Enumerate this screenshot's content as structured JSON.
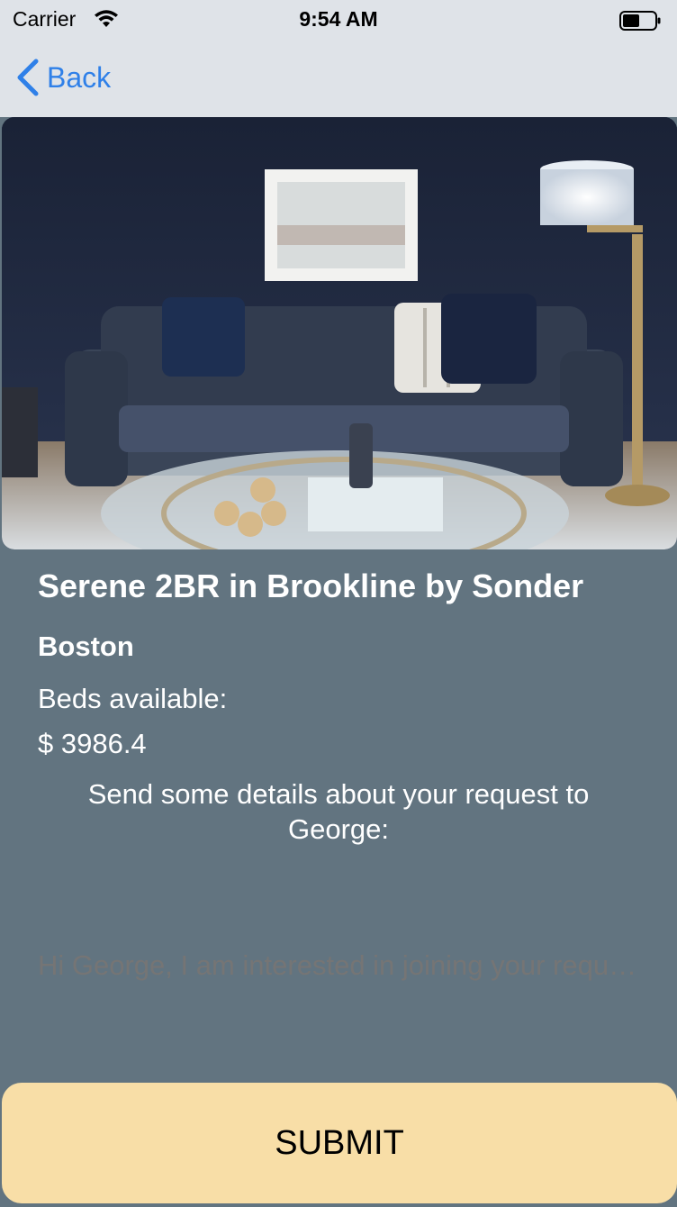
{
  "status_bar": {
    "carrier": "Carrier",
    "time": "9:54 AM",
    "wifi_icon": "wifi-icon",
    "battery_icon": "battery-icon"
  },
  "nav": {
    "back_label": "Back",
    "back_icon": "chevron-left-icon",
    "tint_color": "#2f80e8"
  },
  "listing": {
    "photo_description_icon": "living-room-photo",
    "title": "Serene 2BR in Brookline by Sonder",
    "city": "Boston",
    "beds_label": "Beds available:",
    "price": "$ 3986.4"
  },
  "request": {
    "prompt": "Send some details about your request to George:",
    "message_placeholder": "Hi George, I am interested in joining your request..."
  },
  "actions": {
    "submit_label": "SUBMIT",
    "submit_color": "#f8dea7"
  },
  "colors": {
    "background": "#627480",
    "bar_background": "#dfe3e8"
  }
}
